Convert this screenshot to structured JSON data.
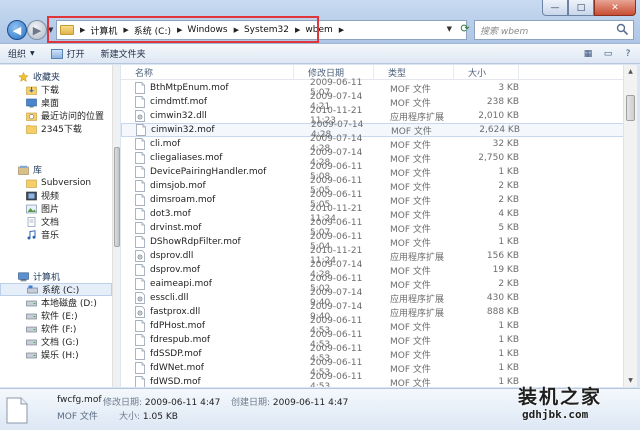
{
  "window": {
    "min": "—",
    "max": "□",
    "close": "✕"
  },
  "address": {
    "crumbs": [
      "计算机",
      "系统 (C:)",
      "Windows",
      "System32",
      "wbem"
    ]
  },
  "search": {
    "placeholder": "搜索 wbem"
  },
  "commandbar": {
    "organize": "组织",
    "open": "打开",
    "new_folder": "新建文件夹"
  },
  "nav": {
    "favorites": {
      "label": "收藏夹",
      "items": [
        "下载",
        "桌面",
        "最近访问的位置",
        "2345下载"
      ]
    },
    "libraries": {
      "label": "库",
      "items": [
        "Subversion",
        "视频",
        "图片",
        "文档",
        "音乐"
      ]
    },
    "computer": {
      "label": "计算机",
      "items": [
        "系统 (C:)",
        "本地磁盘 (D:)",
        "软件 (E:)",
        "软件 (F:)",
        "文档 (G:)",
        "娱乐 (H:)"
      ]
    }
  },
  "columns": {
    "name": "名称",
    "date": "修改日期",
    "type": "类型",
    "size": "大小"
  },
  "files": [
    {
      "name": "BthMtpEnum.mof",
      "date": "2009-06-11 5:07",
      "type": "MOF 文件",
      "size": "3 KB",
      "kind": "mof"
    },
    {
      "name": "cimdmtf.mof",
      "date": "2009-07-14 4:21",
      "type": "MOF 文件",
      "size": "238 KB",
      "kind": "mof"
    },
    {
      "name": "cimwin32.dll",
      "date": "2010-11-21 11:23",
      "type": "应用程序扩展",
      "size": "2,010 KB",
      "kind": "dll"
    },
    {
      "name": "cimwin32.mof",
      "date": "2009-07-14 4:28",
      "type": "MOF 文件",
      "size": "2,624 KB",
      "kind": "mof"
    },
    {
      "name": "cli.mof",
      "date": "2009-07-14 4:28",
      "type": "MOF 文件",
      "size": "32 KB",
      "kind": "mof"
    },
    {
      "name": "cliegaliases.mof",
      "date": "2009-07-14 4:28",
      "type": "MOF 文件",
      "size": "2,750 KB",
      "kind": "mof"
    },
    {
      "name": "DevicePairingHandler.mof",
      "date": "2009-06-11 5:08",
      "type": "MOF 文件",
      "size": "1 KB",
      "kind": "mof"
    },
    {
      "name": "dimsjob.mof",
      "date": "2009-06-11 5:05",
      "type": "MOF 文件",
      "size": "2 KB",
      "kind": "mof"
    },
    {
      "name": "dimsroam.mof",
      "date": "2009-06-11 5:05",
      "type": "MOF 文件",
      "size": "2 KB",
      "kind": "mof"
    },
    {
      "name": "dot3.mof",
      "date": "2010-11-21 11:24",
      "type": "MOF 文件",
      "size": "4 KB",
      "kind": "mof"
    },
    {
      "name": "drvinst.mof",
      "date": "2009-06-11 5:07",
      "type": "MOF 文件",
      "size": "5 KB",
      "kind": "mof"
    },
    {
      "name": "DShowRdpFilter.mof",
      "date": "2009-06-11 5:04",
      "type": "MOF 文件",
      "size": "1 KB",
      "kind": "mof"
    },
    {
      "name": "dsprov.dll",
      "date": "2010-11-21 11:24",
      "type": "应用程序扩展",
      "size": "156 KB",
      "kind": "dll"
    },
    {
      "name": "dsprov.mof",
      "date": "2009-07-14 4:28",
      "type": "MOF 文件",
      "size": "19 KB",
      "kind": "mof"
    },
    {
      "name": "eaimeapi.mof",
      "date": "2009-06-11 5:02",
      "type": "MOF 文件",
      "size": "2 KB",
      "kind": "mof"
    },
    {
      "name": "esscli.dll",
      "date": "2009-07-14 9:40",
      "type": "应用程序扩展",
      "size": "430 KB",
      "kind": "dll"
    },
    {
      "name": "fastprox.dll",
      "date": "2009-07-14 9:40",
      "type": "应用程序扩展",
      "size": "888 KB",
      "kind": "dll"
    },
    {
      "name": "fdPHost.mof",
      "date": "2009-06-11 4:53",
      "type": "MOF 文件",
      "size": "1 KB",
      "kind": "mof"
    },
    {
      "name": "fdrespub.mof",
      "date": "2009-06-11 4:53",
      "type": "MOF 文件",
      "size": "1 KB",
      "kind": "mof"
    },
    {
      "name": "fdSSDP.mof",
      "date": "2009-06-11 4:53",
      "type": "MOF 文件",
      "size": "1 KB",
      "kind": "mof"
    },
    {
      "name": "fdWNet.mof",
      "date": "2009-06-11 4:53",
      "type": "MOF 文件",
      "size": "1 KB",
      "kind": "mof"
    },
    {
      "name": "fdWSD.mof",
      "date": "2009-06-11 4:53",
      "type": "MOF 文件",
      "size": "1 KB",
      "kind": "mof"
    }
  ],
  "details": {
    "name": "fwcfg.mof",
    "type": "MOF 文件",
    "modified_label": "修改日期:",
    "modified": "2009-06-11 4:47",
    "created_label": "创建日期:",
    "created": "2009-06-11 4:47",
    "size_label": "大小:",
    "size": "1.05 KB"
  },
  "watermark": {
    "text": "装机之家",
    "url": "gdhjbk.com"
  },
  "colors": {
    "highlight": "#e0353a",
    "selection": "#c7d8ee"
  }
}
